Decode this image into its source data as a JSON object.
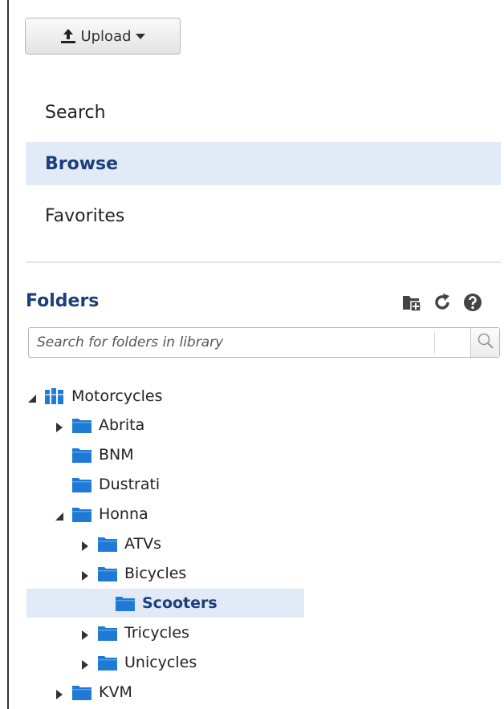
{
  "toolbar": {
    "upload_label": "Upload"
  },
  "nav": {
    "items": [
      {
        "label": "Search",
        "active": false
      },
      {
        "label": "Browse",
        "active": true
      },
      {
        "label": "Favorites",
        "active": false
      }
    ]
  },
  "folders": {
    "title": "Folders",
    "tools": [
      "new-folder-icon",
      "refresh-icon",
      "help-icon"
    ],
    "search_placeholder": "Search for folders in library"
  },
  "tree": {
    "root": {
      "label": "Motorcycles",
      "expanded": true,
      "icon": "library-icon"
    },
    "items": [
      {
        "label": "Abrita",
        "level": 1,
        "toggle": "collapsed"
      },
      {
        "label": "BNM",
        "level": 1,
        "toggle": "none"
      },
      {
        "label": "Dustrati",
        "level": 1,
        "toggle": "none"
      },
      {
        "label": "Honna",
        "level": 1,
        "toggle": "expanded"
      },
      {
        "label": "ATVs",
        "level": 2,
        "toggle": "collapsed"
      },
      {
        "label": "Bicycles",
        "level": 2,
        "toggle": "collapsed"
      },
      {
        "label": "Scooters",
        "level": 2,
        "toggle": "none",
        "selected": true
      },
      {
        "label": "Tricycles",
        "level": 2,
        "toggle": "collapsed"
      },
      {
        "label": "Unicycles",
        "level": 2,
        "toggle": "collapsed"
      },
      {
        "label": "KVM",
        "level": 1,
        "toggle": "collapsed"
      }
    ]
  },
  "colors": {
    "accent": "#1b3f7a",
    "selection_bg": "#e1eaf6",
    "folder_blue": "#1f7ad6"
  }
}
